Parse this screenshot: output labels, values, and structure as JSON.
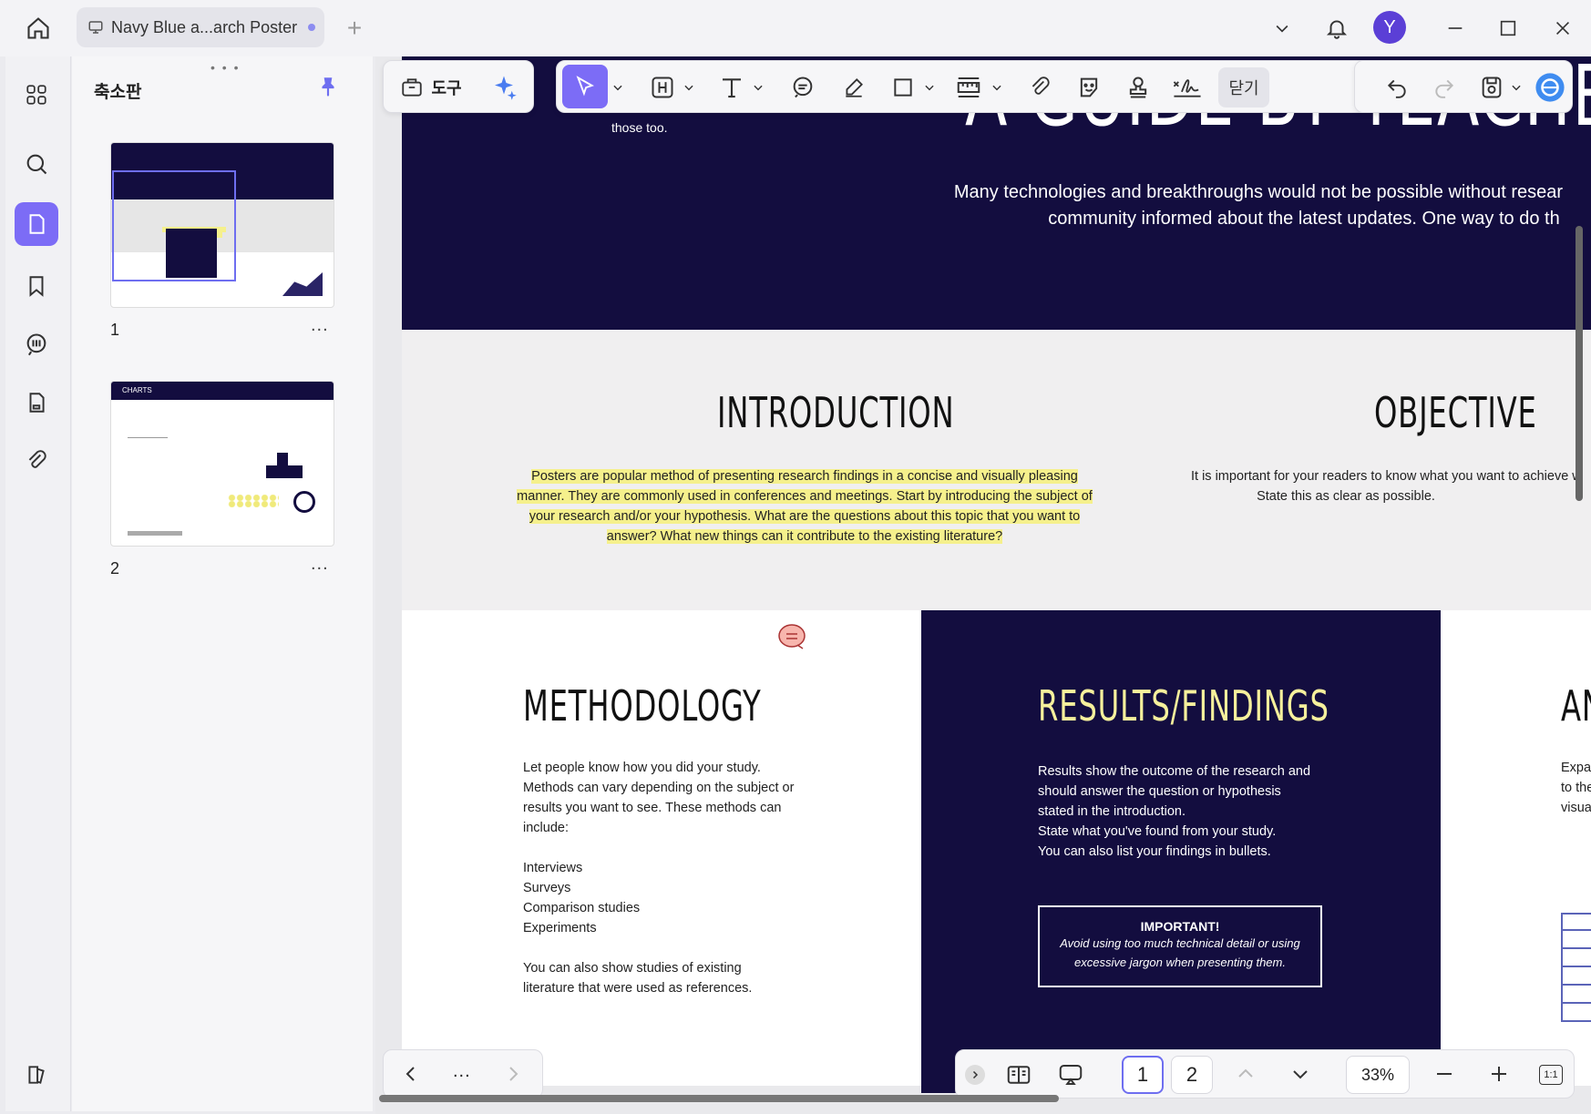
{
  "titlebar": {
    "tab_title": "Navy Blue a...arch Poster",
    "avatar_initial": "Y"
  },
  "panel": {
    "title": "축소판",
    "thumbs": [
      {
        "number": "1",
        "more": "..."
      },
      {
        "number": "2",
        "more": "..."
      }
    ],
    "thumb2_header": "CHARTS"
  },
  "toolbar": {
    "tools_label": "도구",
    "close_label": "닫기"
  },
  "page": {
    "hero_title": "A GUIDE BY TEACHER A",
    "hero_text_line1": "Many technologies and breakthroughs would not be possible without resear",
    "hero_text_line2": "community informed about the latest updates. One way to do th",
    "hero_note": "those too.",
    "introduction_heading": "INTRODUCTION",
    "introduction_text": "Posters are popular method of presenting research findings in a concise and visually pleasing manner. They are commonly used in conferences and meetings. Start by introducing the subject of your research and/or your hypothesis. What are the questions about this topic that you want to answer? What new things can it contribute to the existing literature?",
    "objective_heading": "OBJECTIVE",
    "objective_text_line1": "It is important for your readers to know what you want to achieve w",
    "objective_text_line2": "State this as clear as possible.",
    "methodology_heading": "METHODOLOGY",
    "methodology_intro": "Let people know how you did your study. Methods can vary depending on the subject or results you want to see. These methods can include:",
    "methodology_list": [
      "Interviews",
      "Surveys",
      "Comparison studies",
      "Experiments"
    ],
    "methodology_outro": "You can also show studies of existing literature that were used as references.",
    "results_heading": "RESULTS/FINDINGS",
    "results_text": [
      "Results show the outcome of the research and",
      "should answer the question or hypothesis",
      "stated in the introduction.",
      "State what you've found from your study.",
      "You can also list your findings in bullets."
    ],
    "important_title": "IMPORTANT!",
    "important_text_line1": "Avoid using too much technical detail or using",
    "important_text_line2": "excessive jargon when presenting them.",
    "analysis_heading_partial": "AN",
    "analysis_text": [
      "Expan",
      "to the",
      "visual"
    ]
  },
  "bottombar": {
    "nav_more": "...",
    "pages": [
      "1",
      "2"
    ],
    "zoom": "33%",
    "fit_label": "1:1"
  },
  "colors": {
    "navy": "#130d3f",
    "accent": "#7c6cf6",
    "highlight": "#f5f08c",
    "results_heading": "#f6f09c"
  }
}
